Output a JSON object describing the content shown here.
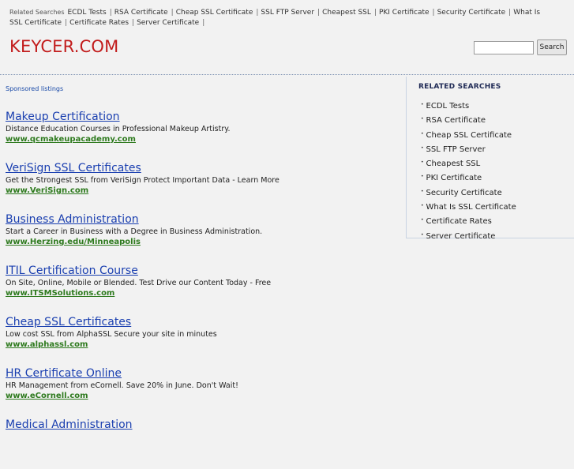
{
  "topbar": {
    "label": "Related Searches",
    "items": [
      "ECDL Tests",
      "RSA Certificate",
      "Cheap SSL Certificate",
      "SSL FTP Server",
      "Cheapest SSL",
      "PKI Certificate",
      "Security Certificate",
      "What Is SSL Certificate",
      "Certificate Rates",
      "Server Certificate"
    ],
    "separator": "|"
  },
  "logo": "KEYCER.COM",
  "search": {
    "button_label": "Search",
    "value": ""
  },
  "sponsored_label": "Sponsored listings",
  "listings": [
    {
      "title": "Makeup Certification",
      "desc": "Distance Education Courses in Professional Makeup Artistry.",
      "url": "www.qcmakeupacademy.com"
    },
    {
      "title": "VeriSign SSL Certificates",
      "desc": "Get the Strongest SSL from VeriSign Protect Important Data - Learn More",
      "url": "www.VeriSign.com"
    },
    {
      "title": "Business Administration",
      "desc": "Start a Career in Business with a Degree in Business Administration.",
      "url": "www.Herzing.edu/Minneapolis"
    },
    {
      "title": "ITIL Certification Course",
      "desc": "On Site, Online, Mobile or Blended. Test Drive our Content Today - Free",
      "url": "www.ITSMSolutions.com"
    },
    {
      "title": "Cheap SSL Certificates",
      "desc": "Low cost SSL from AlphaSSL Secure your site in minutes",
      "url": "www.alphassl.com"
    },
    {
      "title": "HR Certificate Online",
      "desc": "HR Management from eCornell. Save 20% in June. Don't Wait!",
      "url": "www.eCornell.com"
    },
    {
      "title": "Medical Administration",
      "desc": "",
      "url": ""
    }
  ],
  "related": {
    "heading": "RELATED SEARCHES",
    "items": [
      "ECDL Tests",
      "RSA Certificate",
      "Cheap SSL Certificate",
      "SSL FTP Server",
      "Cheapest SSL",
      "PKI Certificate",
      "Security Certificate",
      "What Is SSL Certificate",
      "Certificate Rates",
      "Server Certificate"
    ],
    "bullet": "•"
  },
  "colors": {
    "logo": "#c21c1c",
    "link": "#1a3fb0",
    "url": "#2e7a1e",
    "background": "#f2f2f2"
  }
}
